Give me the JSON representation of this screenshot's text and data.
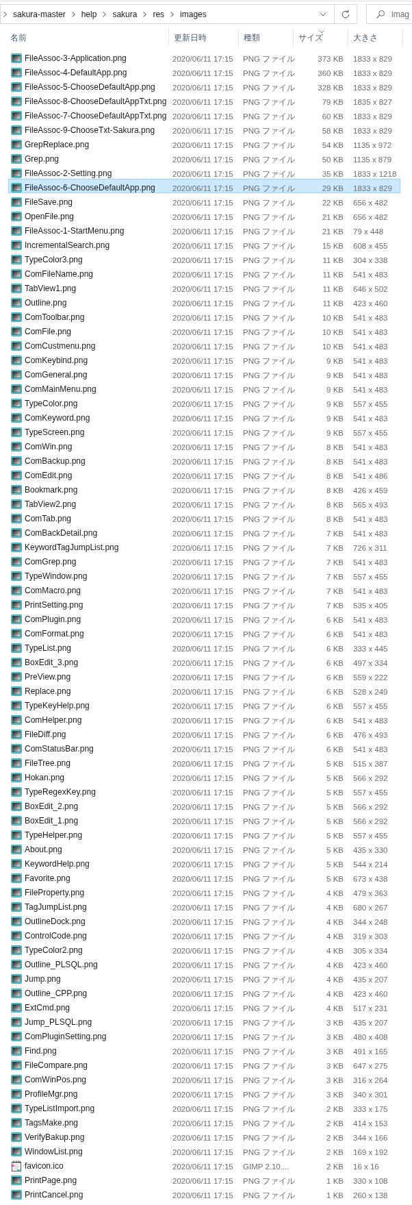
{
  "address_bar": {
    "path": [
      "sakura-master",
      "help",
      "sakura",
      "res",
      "images"
    ],
    "search": {
      "placeholder": "imag"
    }
  },
  "columns": [
    {
      "label": "名前",
      "sorted": false
    },
    {
      "label": "更新日時",
      "sorted": false
    },
    {
      "label": "種類",
      "sorted": false
    },
    {
      "label": "サイズ",
      "sorted": true
    },
    {
      "label": "大きさ",
      "sorted": false
    }
  ],
  "rows": [
    {
      "name": "FileAssoc-3-Application.png",
      "kind": "png",
      "modified": "2020/06/11 17:15",
      "type": "PNG ファイル",
      "size": "373 KB",
      "dimensions": "1833 x 829",
      "selected": false
    },
    {
      "name": "FileAssoc-4-DefaultApp.png",
      "kind": "png",
      "modified": "2020/06/11 17:15",
      "type": "PNG ファイル",
      "size": "360 KB",
      "dimensions": "1833 x 829",
      "selected": false
    },
    {
      "name": "FileAssoc-5-ChooseDefaultApp.png",
      "kind": "png",
      "modified": "2020/06/11 17:15",
      "type": "PNG ファイル",
      "size": "328 KB",
      "dimensions": "1833 x 829",
      "selected": false
    },
    {
      "name": "FileAssoc-8-ChooseDefaultAppTxt.png",
      "kind": "png",
      "modified": "2020/06/11 17:15",
      "type": "PNG ファイル",
      "size": "79 KB",
      "dimensions": "1835 x 827",
      "selected": false
    },
    {
      "name": "FileAssoc-7-ChooseDefaultAppTxt.png",
      "kind": "png",
      "modified": "2020/06/11 17:15",
      "type": "PNG ファイル",
      "size": "60 KB",
      "dimensions": "1833 x 829",
      "selected": false
    },
    {
      "name": "FileAssoc-9-ChooseTxt-Sakura.png",
      "kind": "png",
      "modified": "2020/06/11 17:15",
      "type": "PNG ファイル",
      "size": "58 KB",
      "dimensions": "1833 x 829",
      "selected": false
    },
    {
      "name": "GrepReplace.png",
      "kind": "png",
      "modified": "2020/06/11 17:15",
      "type": "PNG ファイル",
      "size": "54 KB",
      "dimensions": "1135 x 972",
      "selected": false
    },
    {
      "name": "Grep.png",
      "kind": "png",
      "modified": "2020/06/11 17:15",
      "type": "PNG ファイル",
      "size": "50 KB",
      "dimensions": "1135 x 879",
      "selected": false
    },
    {
      "name": "FileAssoc-2-Setting.png",
      "kind": "png",
      "modified": "2020/06/11 17:15",
      "type": "PNG ファイル",
      "size": "35 KB",
      "dimensions": "1833 x 1218",
      "selected": false
    },
    {
      "name": "FileAssoc-6-ChooseDefaultApp.png",
      "kind": "png",
      "modified": "2020/06/11 17:15",
      "type": "PNG ファイル",
      "size": "29 KB",
      "dimensions": "1833 x 829",
      "selected": true
    },
    {
      "name": "FileSave.png",
      "kind": "png",
      "modified": "2020/06/11 17:15",
      "type": "PNG ファイル",
      "size": "22 KB",
      "dimensions": "656 x 482",
      "selected": false
    },
    {
      "name": "OpenFile.png",
      "kind": "png",
      "modified": "2020/06/11 17:15",
      "type": "PNG ファイル",
      "size": "21 KB",
      "dimensions": "656 x 482",
      "selected": false
    },
    {
      "name": "FileAssoc-1-StartMenu.png",
      "kind": "png",
      "modified": "2020/06/11 17:15",
      "type": "PNG ファイル",
      "size": "21 KB",
      "dimensions": "79 x 448",
      "selected": false
    },
    {
      "name": "IncrementalSearch.png",
      "kind": "png",
      "modified": "2020/06/11 17:15",
      "type": "PNG ファイル",
      "size": "15 KB",
      "dimensions": "608 x 455",
      "selected": false
    },
    {
      "name": "TypeColor3.png",
      "kind": "png",
      "modified": "2020/06/11 17:15",
      "type": "PNG ファイル",
      "size": "11 KB",
      "dimensions": "304 x 338",
      "selected": false
    },
    {
      "name": "ComFileName.png",
      "kind": "png",
      "modified": "2020/06/11 17:15",
      "type": "PNG ファイル",
      "size": "11 KB",
      "dimensions": "541 x 483",
      "selected": false
    },
    {
      "name": "TabView1.png",
      "kind": "png",
      "modified": "2020/06/11 17:15",
      "type": "PNG ファイル",
      "size": "11 KB",
      "dimensions": "646 x 502",
      "selected": false
    },
    {
      "name": "Outline.png",
      "kind": "png",
      "modified": "2020/06/11 17:15",
      "type": "PNG ファイル",
      "size": "11 KB",
      "dimensions": "423 x 460",
      "selected": false
    },
    {
      "name": "ComToolbar.png",
      "kind": "png",
      "modified": "2020/06/11 17:15",
      "type": "PNG ファイル",
      "size": "10 KB",
      "dimensions": "541 x 483",
      "selected": false
    },
    {
      "name": "ComFile.png",
      "kind": "png",
      "modified": "2020/06/11 17:15",
      "type": "PNG ファイル",
      "size": "10 KB",
      "dimensions": "541 x 483",
      "selected": false
    },
    {
      "name": "ComCustmenu.png",
      "kind": "png",
      "modified": "2020/06/11 17:15",
      "type": "PNG ファイル",
      "size": "10 KB",
      "dimensions": "541 x 483",
      "selected": false
    },
    {
      "name": "ComKeybind.png",
      "kind": "png",
      "modified": "2020/06/11 17:15",
      "type": "PNG ファイル",
      "size": "9 KB",
      "dimensions": "541 x 483",
      "selected": false
    },
    {
      "name": "ComGeneral.png",
      "kind": "png",
      "modified": "2020/06/11 17:15",
      "type": "PNG ファイル",
      "size": "9 KB",
      "dimensions": "541 x 483",
      "selected": false
    },
    {
      "name": "ComMainMenu.png",
      "kind": "png",
      "modified": "2020/06/11 17:15",
      "type": "PNG ファイル",
      "size": "9 KB",
      "dimensions": "541 x 483",
      "selected": false
    },
    {
      "name": "TypeColor.png",
      "kind": "png",
      "modified": "2020/06/11 17:15",
      "type": "PNG ファイル",
      "size": "9 KB",
      "dimensions": "557 x 455",
      "selected": false
    },
    {
      "name": "ComKeyword.png",
      "kind": "png",
      "modified": "2020/06/11 17:15",
      "type": "PNG ファイル",
      "size": "9 KB",
      "dimensions": "541 x 483",
      "selected": false
    },
    {
      "name": "TypeScreen.png",
      "kind": "png",
      "modified": "2020/06/11 17:15",
      "type": "PNG ファイル",
      "size": "9 KB",
      "dimensions": "557 x 455",
      "selected": false
    },
    {
      "name": "ComWin.png",
      "kind": "png",
      "modified": "2020/06/11 17:15",
      "type": "PNG ファイル",
      "size": "8 KB",
      "dimensions": "541 x 483",
      "selected": false
    },
    {
      "name": "ComBackup.png",
      "kind": "png",
      "modified": "2020/06/11 17:15",
      "type": "PNG ファイル",
      "size": "8 KB",
      "dimensions": "541 x 483",
      "selected": false
    },
    {
      "name": "ComEdit.png",
      "kind": "png",
      "modified": "2020/06/11 17:15",
      "type": "PNG ファイル",
      "size": "8 KB",
      "dimensions": "541 x 486",
      "selected": false
    },
    {
      "name": "Bookmark.png",
      "kind": "png",
      "modified": "2020/06/11 17:15",
      "type": "PNG ファイル",
      "size": "8 KB",
      "dimensions": "426 x 459",
      "selected": false
    },
    {
      "name": "TabView2.png",
      "kind": "png",
      "modified": "2020/06/11 17:15",
      "type": "PNG ファイル",
      "size": "8 KB",
      "dimensions": "565 x 493",
      "selected": false
    },
    {
      "name": "ComTab.png",
      "kind": "png",
      "modified": "2020/06/11 17:15",
      "type": "PNG ファイル",
      "size": "8 KB",
      "dimensions": "541 x 483",
      "selected": false
    },
    {
      "name": "ComBackDetail.png",
      "kind": "png",
      "modified": "2020/06/11 17:15",
      "type": "PNG ファイル",
      "size": "7 KB",
      "dimensions": "541 x 483",
      "selected": false
    },
    {
      "name": "KeywordTagJumpList.png",
      "kind": "png",
      "modified": "2020/06/11 17:15",
      "type": "PNG ファイル",
      "size": "7 KB",
      "dimensions": "726 x 311",
      "selected": false
    },
    {
      "name": "ComGrep.png",
      "kind": "png",
      "modified": "2020/06/11 17:15",
      "type": "PNG ファイル",
      "size": "7 KB",
      "dimensions": "541 x 483",
      "selected": false
    },
    {
      "name": "TypeWindow.png",
      "kind": "png",
      "modified": "2020/06/11 17:15",
      "type": "PNG ファイル",
      "size": "7 KB",
      "dimensions": "557 x 455",
      "selected": false
    },
    {
      "name": "ComMacro.png",
      "kind": "png",
      "modified": "2020/06/11 17:15",
      "type": "PNG ファイル",
      "size": "7 KB",
      "dimensions": "541 x 483",
      "selected": false
    },
    {
      "name": "PrintSetting.png",
      "kind": "png",
      "modified": "2020/06/11 17:15",
      "type": "PNG ファイル",
      "size": "7 KB",
      "dimensions": "535 x 405",
      "selected": false
    },
    {
      "name": "ComPlugin.png",
      "kind": "png",
      "modified": "2020/06/11 17:15",
      "type": "PNG ファイル",
      "size": "6 KB",
      "dimensions": "541 x 483",
      "selected": false
    },
    {
      "name": "ComFormat.png",
      "kind": "png",
      "modified": "2020/06/11 17:15",
      "type": "PNG ファイル",
      "size": "6 KB",
      "dimensions": "541 x 483",
      "selected": false
    },
    {
      "name": "TypeList.png",
      "kind": "png",
      "modified": "2020/06/11 17:15",
      "type": "PNG ファイル",
      "size": "6 KB",
      "dimensions": "333 x 445",
      "selected": false
    },
    {
      "name": "BoxEdit_3.png",
      "kind": "png",
      "modified": "2020/06/11 17:15",
      "type": "PNG ファイル",
      "size": "6 KB",
      "dimensions": "497 x 334",
      "selected": false
    },
    {
      "name": "PreView.png",
      "kind": "png",
      "modified": "2020/06/11 17:15",
      "type": "PNG ファイル",
      "size": "6 KB",
      "dimensions": "559 x 222",
      "selected": false
    },
    {
      "name": "Replace.png",
      "kind": "png",
      "modified": "2020/06/11 17:15",
      "type": "PNG ファイル",
      "size": "6 KB",
      "dimensions": "528 x 249",
      "selected": false
    },
    {
      "name": "TypeKeyHelp.png",
      "kind": "png",
      "modified": "2020/06/11 17:15",
      "type": "PNG ファイル",
      "size": "6 KB",
      "dimensions": "557 x 455",
      "selected": false
    },
    {
      "name": "ComHelper.png",
      "kind": "png",
      "modified": "2020/06/11 17:15",
      "type": "PNG ファイル",
      "size": "6 KB",
      "dimensions": "541 x 483",
      "selected": false
    },
    {
      "name": "FileDiff.png",
      "kind": "png",
      "modified": "2020/06/11 17:15",
      "type": "PNG ファイル",
      "size": "6 KB",
      "dimensions": "476 x 493",
      "selected": false
    },
    {
      "name": "ComStatusBar.png",
      "kind": "png",
      "modified": "2020/06/11 17:15",
      "type": "PNG ファイル",
      "size": "6 KB",
      "dimensions": "541 x 483",
      "selected": false
    },
    {
      "name": "FileTree.png",
      "kind": "png",
      "modified": "2020/06/11 17:15",
      "type": "PNG ファイル",
      "size": "5 KB",
      "dimensions": "515 x 387",
      "selected": false
    },
    {
      "name": "Hokan.png",
      "kind": "png",
      "modified": "2020/06/11 17:15",
      "type": "PNG ファイル",
      "size": "5 KB",
      "dimensions": "566 x 292",
      "selected": false
    },
    {
      "name": "TypeRegexKey.png",
      "kind": "png",
      "modified": "2020/06/11 17:15",
      "type": "PNG ファイル",
      "size": "5 KB",
      "dimensions": "557 x 455",
      "selected": false
    },
    {
      "name": "BoxEdit_2.png",
      "kind": "png",
      "modified": "2020/06/11 17:15",
      "type": "PNG ファイル",
      "size": "5 KB",
      "dimensions": "566 x 292",
      "selected": false
    },
    {
      "name": "BoxEdit_1.png",
      "kind": "png",
      "modified": "2020/06/11 17:15",
      "type": "PNG ファイル",
      "size": "5 KB",
      "dimensions": "566 x 292",
      "selected": false
    },
    {
      "name": "TypeHelper.png",
      "kind": "png",
      "modified": "2020/06/11 17:15",
      "type": "PNG ファイル",
      "size": "5 KB",
      "dimensions": "557 x 455",
      "selected": false
    },
    {
      "name": "About.png",
      "kind": "png",
      "modified": "2020/06/11 17:15",
      "type": "PNG ファイル",
      "size": "5 KB",
      "dimensions": "435 x 330",
      "selected": false
    },
    {
      "name": "KeywordHelp.png",
      "kind": "png",
      "modified": "2020/06/11 17:15",
      "type": "PNG ファイル",
      "size": "5 KB",
      "dimensions": "544 x 214",
      "selected": false
    },
    {
      "name": "Favorite.png",
      "kind": "png",
      "modified": "2020/06/11 17:15",
      "type": "PNG ファイル",
      "size": "5 KB",
      "dimensions": "673 x 438",
      "selected": false
    },
    {
      "name": "FileProperty.png",
      "kind": "png",
      "modified": "2020/06/11 17:15",
      "type": "PNG ファイル",
      "size": "4 KB",
      "dimensions": "479 x 363",
      "selected": false
    },
    {
      "name": "TagJumpList.png",
      "kind": "png",
      "modified": "2020/06/11 17:15",
      "type": "PNG ファイル",
      "size": "4 KB",
      "dimensions": "680 x 267",
      "selected": false
    },
    {
      "name": "OutlineDock.png",
      "kind": "png",
      "modified": "2020/06/11 17:15",
      "type": "PNG ファイル",
      "size": "4 KB",
      "dimensions": "344 x 248",
      "selected": false
    },
    {
      "name": "ControlCode.png",
      "kind": "png",
      "modified": "2020/06/11 17:15",
      "type": "PNG ファイル",
      "size": "4 KB",
      "dimensions": "319 x 303",
      "selected": false
    },
    {
      "name": "TypeColor2.png",
      "kind": "png",
      "modified": "2020/06/11 17:15",
      "type": "PNG ファイル",
      "size": "4 KB",
      "dimensions": "305 x 334",
      "selected": false
    },
    {
      "name": "Outline_PLSQL.png",
      "kind": "png",
      "modified": "2020/06/11 17:15",
      "type": "PNG ファイル",
      "size": "4 KB",
      "dimensions": "423 x 460",
      "selected": false
    },
    {
      "name": "Jump.png",
      "kind": "png",
      "modified": "2020/06/11 17:15",
      "type": "PNG ファイル",
      "size": "4 KB",
      "dimensions": "435 x 207",
      "selected": false
    },
    {
      "name": "Outline_CPP.png",
      "kind": "png",
      "modified": "2020/06/11 17:15",
      "type": "PNG ファイル",
      "size": "4 KB",
      "dimensions": "423 x 460",
      "selected": false
    },
    {
      "name": "ExtCmd.png",
      "kind": "png",
      "modified": "2020/06/11 17:15",
      "type": "PNG ファイル",
      "size": "4 KB",
      "dimensions": "517 x 231",
      "selected": false
    },
    {
      "name": "Jump_PLSQL.png",
      "kind": "png",
      "modified": "2020/06/11 17:15",
      "type": "PNG ファイル",
      "size": "3 KB",
      "dimensions": "435 x 207",
      "selected": false
    },
    {
      "name": "ComPluginSetting.png",
      "kind": "png",
      "modified": "2020/06/11 17:15",
      "type": "PNG ファイル",
      "size": "3 KB",
      "dimensions": "480 x 408",
      "selected": false
    },
    {
      "name": "Find.png",
      "kind": "png",
      "modified": "2020/06/11 17:15",
      "type": "PNG ファイル",
      "size": "3 KB",
      "dimensions": "491 x 165",
      "selected": false
    },
    {
      "name": "FileCompare.png",
      "kind": "png",
      "modified": "2020/06/11 17:15",
      "type": "PNG ファイル",
      "size": "3 KB",
      "dimensions": "647 x 275",
      "selected": false
    },
    {
      "name": "ComWinPos.png",
      "kind": "png",
      "modified": "2020/06/11 17:15",
      "type": "PNG ファイル",
      "size": "3 KB",
      "dimensions": "316 x 264",
      "selected": false
    },
    {
      "name": "ProfileMgr.png",
      "kind": "png",
      "modified": "2020/06/11 17:15",
      "type": "PNG ファイル",
      "size": "3 KB",
      "dimensions": "340 x 301",
      "selected": false
    },
    {
      "name": "TypeListImport.png",
      "kind": "png",
      "modified": "2020/06/11 17:15",
      "type": "PNG ファイル",
      "size": "2 KB",
      "dimensions": "333 x 175",
      "selected": false
    },
    {
      "name": "TagsMake.png",
      "kind": "png",
      "modified": "2020/06/11 17:15",
      "type": "PNG ファイル",
      "size": "2 KB",
      "dimensions": "414 x 153",
      "selected": false
    },
    {
      "name": "VerifyBakup.png",
      "kind": "png",
      "modified": "2020/06/11 17:15",
      "type": "PNG ファイル",
      "size": "2 KB",
      "dimensions": "344 x 166",
      "selected": false
    },
    {
      "name": "WindowList.png",
      "kind": "png",
      "modified": "2020/06/11 17:15",
      "type": "PNG ファイル",
      "size": "2 KB",
      "dimensions": "169 x 192",
      "selected": false
    },
    {
      "name": "favicon.ico",
      "kind": "ico",
      "modified": "2020/06/11 17:15",
      "type": "GIMP 2.10....",
      "size": "2 KB",
      "dimensions": "16 x 16",
      "selected": false
    },
    {
      "name": "PrintPage.png",
      "kind": "png",
      "modified": "2020/06/11 17:15",
      "type": "PNG ファイル",
      "size": "1 KB",
      "dimensions": "330 x 108",
      "selected": false
    },
    {
      "name": "PrintCancel.png",
      "kind": "png",
      "modified": "2020/06/11 17:15",
      "type": "PNG ファイル",
      "size": "1 KB",
      "dimensions": "260 x 138",
      "selected": false
    }
  ]
}
